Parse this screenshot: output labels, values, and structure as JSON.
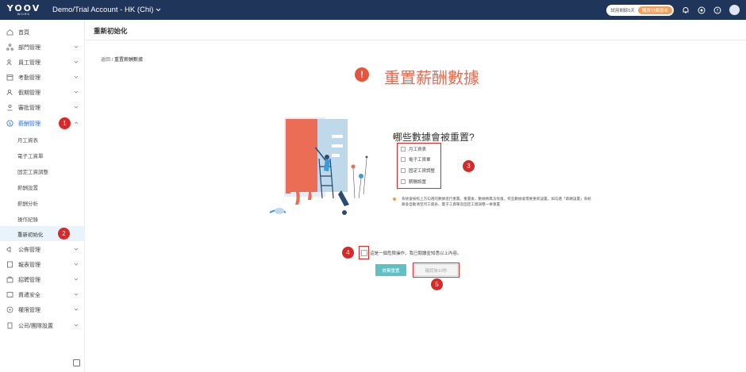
{
  "topbar": {
    "logo_top": "YOOV",
    "logo_bottom": "WORK",
    "account": "Demo/Trial Account - HK (Chi)",
    "trial_text": "試用剩餘5天",
    "buy_label": "購買付費版本"
  },
  "sidebar": {
    "items": [
      {
        "label": "首頁",
        "icon": "home-icon"
      },
      {
        "label": "部門管理",
        "icon": "org-icon"
      },
      {
        "label": "員工管理",
        "icon": "users-icon"
      },
      {
        "label": "考勤管理",
        "icon": "calendar-icon"
      },
      {
        "label": "假期管理",
        "icon": "leave-icon"
      },
      {
        "label": "審批管理",
        "icon": "approval-icon"
      },
      {
        "label": "薪酬管理",
        "icon": "payroll-icon"
      },
      {
        "label": "月工資表"
      },
      {
        "label": "電子工資單"
      },
      {
        "label": "固定工資調整"
      },
      {
        "label": "薪酬設置"
      },
      {
        "label": "薪酬分析"
      },
      {
        "label": "操作紀錄"
      },
      {
        "label": "重新初始化"
      },
      {
        "label": "公佈管理",
        "icon": "announce-icon"
      },
      {
        "label": "報表管理",
        "icon": "report-icon"
      },
      {
        "label": "招聘管理",
        "icon": "recruit-icon"
      },
      {
        "label": "資遣安全",
        "icon": "safety-icon"
      },
      {
        "label": "權限管理",
        "icon": "permission-icon"
      },
      {
        "label": "公司/團隊設置",
        "icon": "company-icon"
      }
    ]
  },
  "header": {
    "title": "重新初始化"
  },
  "main": {
    "breadcrumb_back": "返回",
    "breadcrumb_current": "重置薪酬數據",
    "title": "重置薪酬數據",
    "question": "哪些數據會被重置?",
    "options": [
      "月工資表",
      "電子工資單",
      "固定工資調整",
      "薪酬設置"
    ],
    "note": "系統會按照上方勾選的數據進行重置。重置後，數據將無法恢復，有些數據會需要重新設置。如勾選「薪酬設置」系統將會自動清空月工資表、電子工資單及固定工資調整一併重置",
    "confirm": "這是一個危險操作，我已閱讀並知悉以上內容。",
    "cancel_label": "放棄重置",
    "reset_label": "確認後10秒"
  },
  "annotations": [
    "1",
    "2",
    "3",
    "4",
    "5"
  ],
  "colors": {
    "topbar": "#1f3559",
    "accent": "#e86a4f",
    "badge": "#d42a2a",
    "cancel": "#5fc0c5"
  }
}
